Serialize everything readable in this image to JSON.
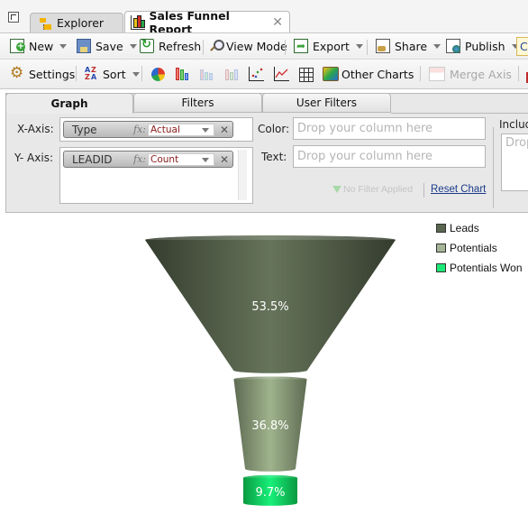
{
  "window": {
    "tabs": [
      {
        "label": "Explorer",
        "icon": "folder-tree-icon",
        "active": false
      },
      {
        "label": "Sales Funnel Report",
        "icon": "bar-chart-icon",
        "active": true,
        "closable": true
      }
    ]
  },
  "toolbar": {
    "new_label": "New",
    "save_label": "Save",
    "refresh_label": "Refresh",
    "view_mode_label": "View Mode",
    "export_label": "Export",
    "share_label": "Share",
    "publish_label": "Publish",
    "cut_label": "C"
  },
  "chart_toolbar": {
    "settings_label": "Settings",
    "sort_label": "Sort",
    "chart_type_icons": [
      "pie-chart-icon",
      "bar-chart-icon",
      "stacked-bar-chart-icon",
      "combo-chart-icon",
      "scatter-chart-icon",
      "line-chart-icon",
      "table-icon"
    ],
    "other_charts_label": "Other Charts",
    "merge_axis_label": "Merge Axis"
  },
  "panel": {
    "tabs": [
      {
        "label": "Graph",
        "active": true
      },
      {
        "label": "Filters",
        "active": false
      },
      {
        "label": "User Filters",
        "active": false
      }
    ],
    "x_axis": {
      "label": "X-Axis:",
      "column": "Type",
      "fx": "fx:",
      "aggregate": "Actual"
    },
    "y_axis": {
      "label": "Y- Axis:",
      "column": "LEADID",
      "fx": "fx:",
      "aggregate": "Count"
    },
    "color": {
      "label": "Color:",
      "placeholder": "Drop your column here"
    },
    "text": {
      "label": "Text:",
      "placeholder": "Drop your column here"
    },
    "include": {
      "label": "Includ",
      "placeholder": "Drop"
    },
    "filter_status": "No Filter Applied",
    "reset_chart_label": "Reset Chart"
  },
  "chart_data": {
    "type": "funnel",
    "title": "",
    "categories": [
      "Leads",
      "Potentials",
      "Potentials Won"
    ],
    "values_percent": [
      53.5,
      36.8,
      9.7
    ],
    "data_labels": [
      "53.5%",
      "36.8%",
      "9.7%"
    ],
    "colors": [
      "#4f5c46",
      "#8fa27e",
      "#12c25a"
    ],
    "legend": {
      "position": "top-right",
      "entries": [
        {
          "label": "Leads",
          "color": "#5a6650"
        },
        {
          "label": "Potentials",
          "color": "#a4b596"
        },
        {
          "label": "Potentials Won",
          "color": "#1ee878"
        }
      ]
    }
  }
}
